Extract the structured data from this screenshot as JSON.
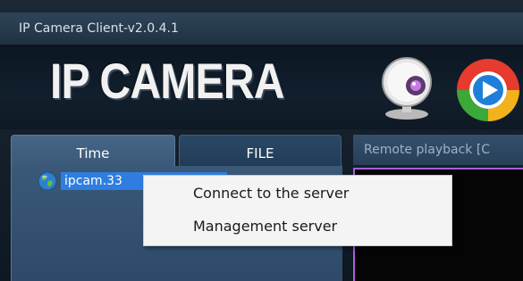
{
  "window": {
    "title": "IP Camera Client-v2.0.4.1"
  },
  "banner": {
    "logo_text": "IP CAMERA",
    "icons": [
      "webcam-icon",
      "play-icon"
    ]
  },
  "tabs": [
    {
      "label": "Time"
    },
    {
      "label": "FILE"
    }
  ],
  "tree": {
    "items": [
      {
        "label": "ipcam.33",
        "icon": "globe-icon"
      }
    ]
  },
  "right_panel": {
    "header": "Remote playback [C"
  },
  "context_menu": {
    "items": [
      {
        "label": "Connect to the server"
      },
      {
        "label": "Management server"
      }
    ]
  },
  "colors": {
    "selection": "#2f7de0",
    "video_border": "#a85fd8"
  }
}
